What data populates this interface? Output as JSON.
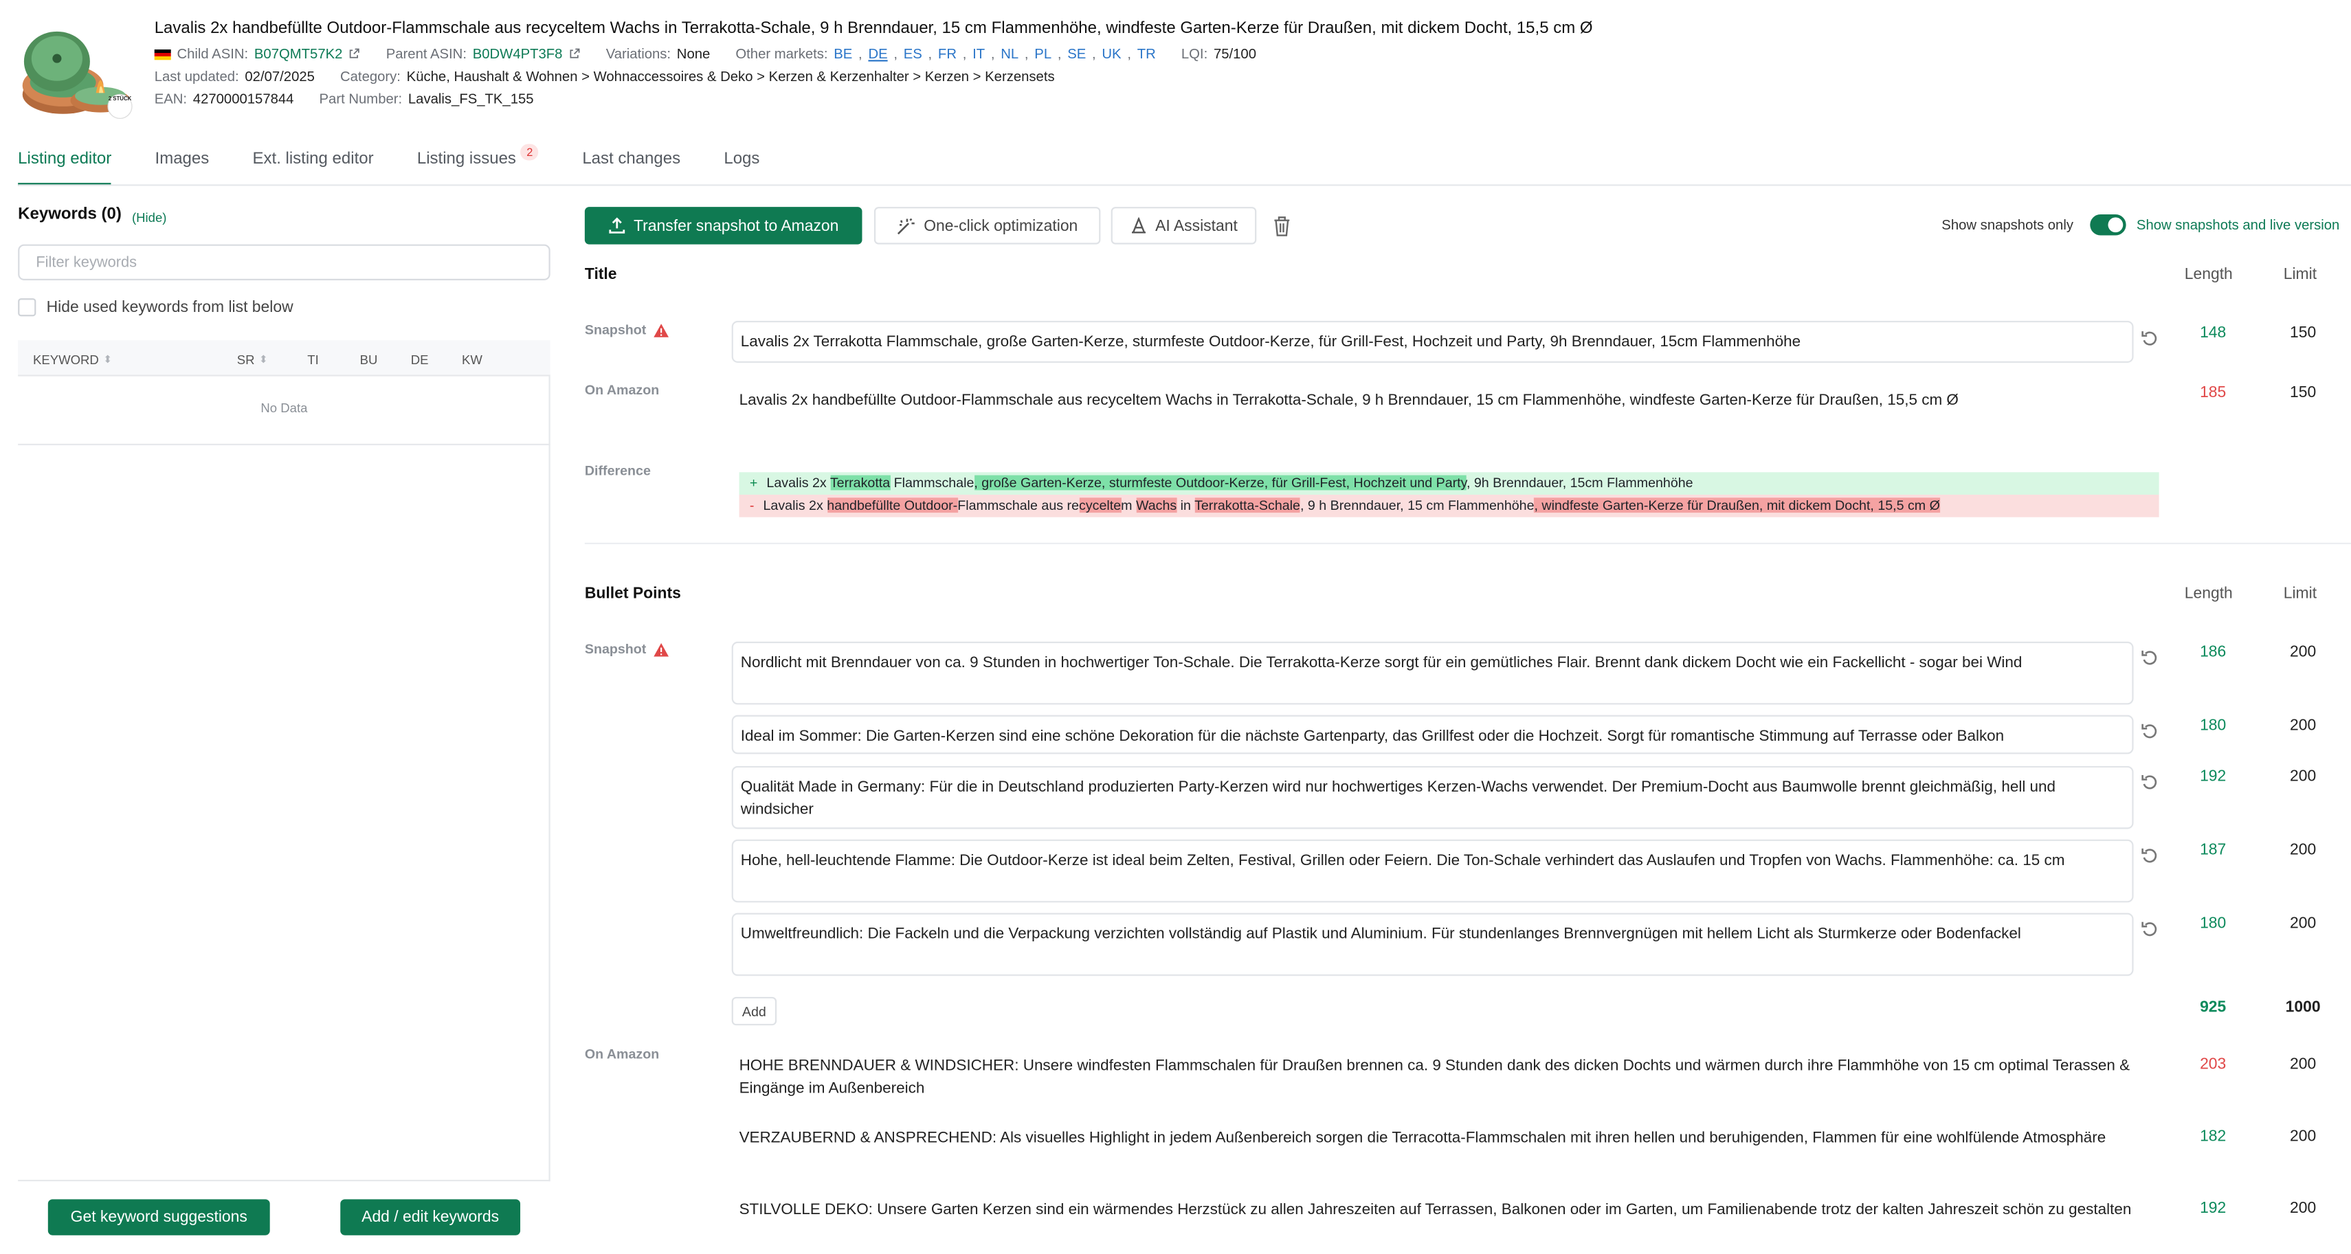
{
  "product": {
    "title": "Lavalis 2x handbefüllte Outdoor-Flammschale aus recyceltem Wachs in Terrakotta-Schale, 9 h Brenndauer, 15 cm Flammenhöhe, windfeste Garten-Kerze für Draußen, mit dickem Docht, 15,5 cm Ø",
    "image_badge": "2 STÜCK",
    "child_asin_label": "Child ASIN:",
    "child_asin": "B07QMT57K2",
    "parent_asin_label": "Parent ASIN:",
    "parent_asin": "B0DW4PT3F8",
    "variations_label": "Variations:",
    "variations": "None",
    "other_markets_label": "Other markets:",
    "markets": [
      "BE",
      "DE",
      "ES",
      "FR",
      "IT",
      "NL",
      "PL",
      "SE",
      "UK",
      "TR"
    ],
    "lqi_label": "LQI:",
    "lqi": "75/100",
    "last_updated_label": "Last updated:",
    "last_updated": "02/07/2025",
    "category_label": "Category:",
    "category": "Küche, Haushalt & Wohnen > Wohnaccessoires & Deko > Kerzen & Kerzenhalter > Kerzen > Kerzensets",
    "ean_label": "EAN:",
    "ean": "4270000157844",
    "part_label": "Part Number:",
    "part_number": "Lavalis_FS_TK_155"
  },
  "tabs": [
    {
      "label": "Listing editor"
    },
    {
      "label": "Images"
    },
    {
      "label": "Ext. listing editor"
    },
    {
      "label": "Listing issues",
      "badge": "2"
    },
    {
      "label": "Last changes"
    },
    {
      "label": "Logs"
    }
  ],
  "keywords": {
    "title": "Keywords (0)",
    "hide": "(Hide)",
    "filter_placeholder": "Filter keywords",
    "hide_used": "Hide used keywords from list below",
    "columns": [
      "KEYWORD",
      "SR",
      "TI",
      "BU",
      "DE",
      "KW"
    ],
    "no_data": "No Data",
    "suggest_button": "Get keyword suggestions",
    "edit_button": "Add / edit keywords"
  },
  "toolbar": {
    "transfer": "Transfer snapshot to Amazon",
    "oneclick": "One-click optimization",
    "ai": "AI Assistant",
    "show_snapshots_only": "Show snapshots only",
    "show_snapshots_live": "Show snapshots and live version"
  },
  "columns": {
    "length": "Length",
    "limit": "Limit"
  },
  "labels": {
    "snapshot": "Snapshot",
    "on_amazon": "On Amazon",
    "difference": "Difference",
    "add": "Add"
  },
  "title_section": {
    "heading": "Title",
    "snapshot": "Lavalis 2x Terrakotta Flammschale, große Garten-Kerze, sturmfeste Outdoor-Kerze, für Grill-Fest, Hochzeit und Party, 9h Brenndauer, 15cm Flammenhöhe",
    "snapshot_length": "148",
    "snapshot_limit": "150",
    "amazon": "Lavalis 2x handbefüllte Outdoor-Flammschale aus recyceltem Wachs in Terrakotta-Schale, 9 h Brenndauer, 15 cm Flammenhöhe, windfeste Garten-Kerze für Draußen, 15,5 cm Ø",
    "amazon_length": "185",
    "amazon_limit": "150",
    "diff_add_marker": "+",
    "diff_del_marker": "-",
    "diff_add_segments": [
      {
        "t": "Lavalis 2x ",
        "h": false
      },
      {
        "t": "Terrakotta",
        "h": true
      },
      {
        "t": " Flammschale",
        "h": false
      },
      {
        "t": ", große Garten-Kerze, sturmfeste Outdoor-Kerze, für Grill-Fest, Hochzeit und Party",
        "h": true
      },
      {
        "t": ", 9h Brenndauer, 15cm Flammenhöhe",
        "h": false
      }
    ],
    "diff_del_segments": [
      {
        "t": "Lavalis 2x ",
        "h": false
      },
      {
        "t": "handbefüllte Outdoor-",
        "h": true
      },
      {
        "t": "Flammschale aus re",
        "h": false
      },
      {
        "t": "cycelte",
        "h": true
      },
      {
        "t": "m ",
        "h": false
      },
      {
        "t": "Wachs",
        "h": true
      },
      {
        "t": " in ",
        "h": false
      },
      {
        "t": "Terrakotta-Schale",
        "h": true
      },
      {
        "t": ", 9 h Brenndauer, 15 cm Flammenhöhe",
        "h": false
      },
      {
        "t": ", windfeste Garten-Kerze für Draußen, mit dickem Docht, 15,5 cm Ø",
        "h": true
      }
    ]
  },
  "bullets_section": {
    "heading": "Bullet Points",
    "snapshots": [
      {
        "text": "Nordlicht mit Brenndauer von ca. 9 Stunden in hochwertiger Ton-Schale. Die Terrakotta-Kerze sorgt für ein gemütliches Flair. Brennt dank dickem Docht wie ein Fackellicht - sogar bei Wind",
        "length": "186",
        "limit": "200"
      },
      {
        "text": "Ideal im Sommer: Die Garten-Kerzen sind eine schöne Dekoration für die nächste Gartenparty, das Grillfest oder die Hochzeit. Sorgt für romantische Stimmung auf Terrasse oder Balkon",
        "length": "180",
        "limit": "200"
      },
      {
        "text": "Qualität Made in Germany: Für die in Deutschland produzierten Party-Kerzen wird nur hochwertiges Kerzen-Wachs verwendet. Der Premium-Docht aus Baumwolle brennt gleichmäßig, hell und windsicher",
        "length": "192",
        "limit": "200"
      },
      {
        "text": "Hohe, hell-leuchtende Flamme: Die Outdoor-Kerze ist ideal beim Zelten, Festival, Grillen oder Feiern. Die Ton-Schale verhindert das Auslaufen und Tropfen von Wachs. Flammenhöhe: ca. 15 cm",
        "length": "187",
        "limit": "200"
      },
      {
        "text": "Umweltfreundlich: Die Fackeln und die Verpackung verzichten vollständig auf Plastik und Aluminium. Für stundenlanges Brennvergnügen mit hellem Licht als Sturmkerze oder Bodenfackel",
        "length": "180",
        "limit": "200"
      }
    ],
    "total_length": "925",
    "total_limit": "1000",
    "amazon": [
      {
        "text": "HOHE BRENNDAUER & WINDSICHER: Unsere windfesten Flammschalen für Draußen brennen ca. 9 Stunden dank des dicken Dochts und wärmen durch ihre Flammhöhe von 15 cm optimal Terassen & Eingänge im Außenbereich",
        "length": "203",
        "limit": "200"
      },
      {
        "text": "VERZAUBERND & ANSPRECHEND: Als visuelles Highlight in jedem Außenbereich sorgen die Terracotta-Flammschalen mit ihren hellen und beruhigenden, Flammen für eine wohlfülende Atmosphäre",
        "length": "182",
        "limit": "200"
      },
      {
        "text": "STILVOLLE DEKO: Unsere Garten Kerzen sind ein wärmendes Herzstück zu allen Jahreszeiten auf Terrassen, Balkonen oder im Garten, um Familienabende trotz der kalten Jahreszeit schön zu gestalten",
        "length": "192",
        "limit": "200"
      }
    ]
  },
  "colors": {
    "accent": "#0f7a52",
    "over_limit": "#e04848",
    "ok": "#0d8a5c"
  }
}
